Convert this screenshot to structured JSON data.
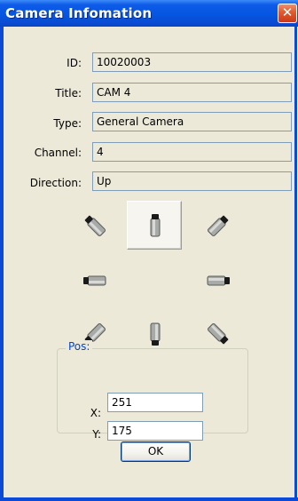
{
  "window": {
    "title": "Camera Infomation",
    "close_glyph": "✕"
  },
  "fields": {
    "id": {
      "label": "ID:",
      "value": "10020003"
    },
    "title": {
      "label": "Title:",
      "value": "CAM 4"
    },
    "type": {
      "label": "Type:",
      "value": "General Camera"
    },
    "channel": {
      "label": "Channel:",
      "value": "4"
    },
    "direction": {
      "label": "Direction:",
      "value": "Up"
    }
  },
  "direction_pad": {
    "selected": "up",
    "buttons": [
      "up-left",
      "up",
      "up-right",
      "left",
      "right",
      "down-left",
      "down",
      "down-right"
    ],
    "icon": "camera-icon"
  },
  "pos": {
    "legend": "Pos:",
    "x": {
      "label": "X:",
      "value": "251"
    },
    "y": {
      "label": "Y:",
      "value": "175"
    }
  },
  "ok_button": {
    "label": "OK"
  },
  "colors": {
    "titlebar": "#0556e0",
    "client": "#ece9d8",
    "field_border": "#7f9db9",
    "group_legend": "#0046d5",
    "close": "#e05a2c"
  }
}
